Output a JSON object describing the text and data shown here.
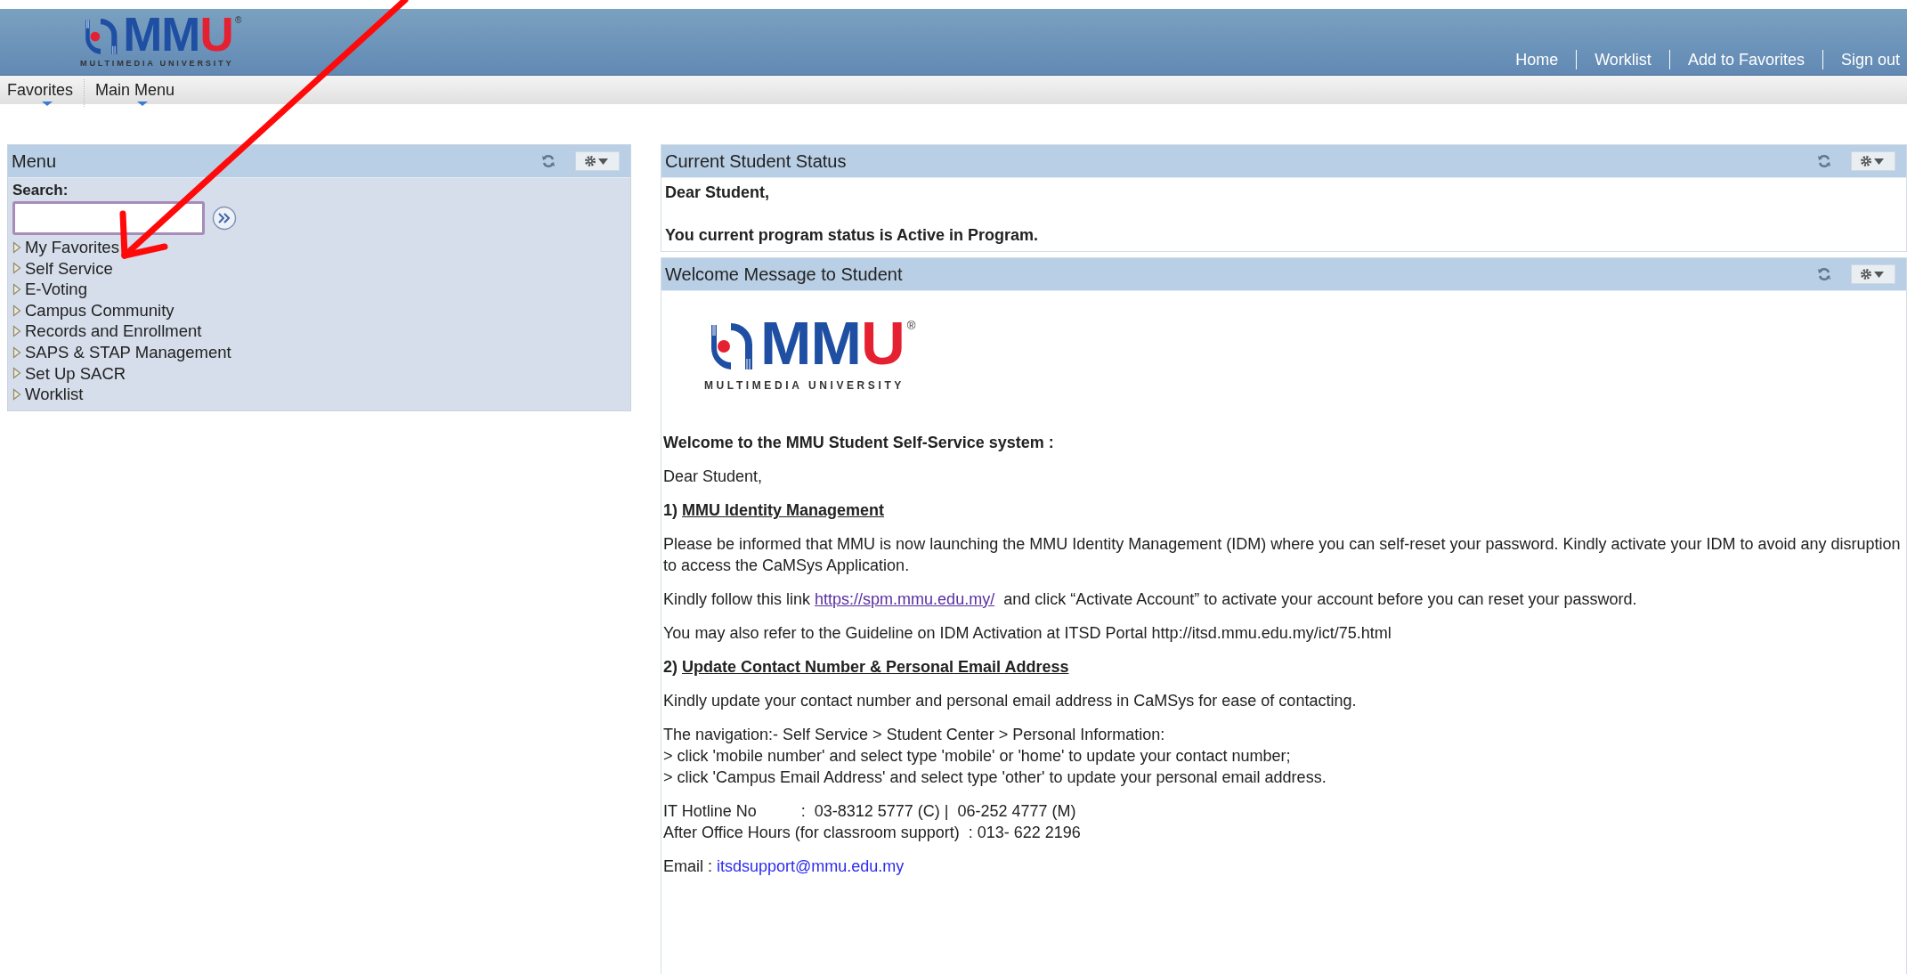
{
  "header": {
    "logo": {
      "mark": "MMU",
      "registered": "®",
      "tagline": "MULTIMEDIA UNIVERSITY"
    },
    "links": [
      "Home",
      "Worklist",
      "Add to Favorites",
      "Sign out"
    ]
  },
  "nav": [
    {
      "label": "Favorites"
    },
    {
      "label": "Main Menu"
    }
  ],
  "menu_panel": {
    "title": "Menu",
    "search": {
      "label": "Search:"
    },
    "items": [
      {
        "label": "My Favorites",
        "expanded": false
      },
      {
        "label": "Self Service",
        "expanded": false
      },
      {
        "label": "E-Voting",
        "expanded": false
      },
      {
        "label": "Campus Community",
        "expanded": false
      },
      {
        "label": "Records and Enrollment",
        "expanded": false
      },
      {
        "label": "SAPS & STAP Management",
        "expanded": false
      },
      {
        "label": "Set Up SACR",
        "expanded": false
      },
      {
        "label": "Worklist",
        "expanded": false
      }
    ]
  },
  "status_panel": {
    "title": "Current Student Status",
    "lines": [
      "Dear Student,",
      "You current program status is Active in Program."
    ]
  },
  "welcome_panel": {
    "title": "Welcome Message to Student",
    "logo": {
      "mark": "MMU",
      "registered": "®",
      "tagline": "MULTIMEDIA UNIVERSITY"
    },
    "blocks": [
      {
        "kind": "heading",
        "text": "Welcome to the MMU Student Self-Service system :"
      },
      {
        "kind": "text",
        "text": "Dear Student,"
      },
      {
        "kind": "section",
        "number": "1)",
        "title": "MMU Identity Management"
      },
      {
        "kind": "text",
        "text": "Please be informed that MMU is now launching the MMU Identity Management (IDM) where you can self-reset your password. Kindly activate your IDM to avoid any disruption to access the CaMSys Application."
      },
      {
        "kind": "link_text",
        "before": "Kindly follow this link ",
        "link": "https://spm.mmu.edu.my/",
        "after": "  and click “Activate Account” to activate your account before you can reset your password."
      },
      {
        "kind": "text",
        "text": "You may also refer to the Guideline on IDM Activation at ITSD Portal http://itsd.mmu.edu.my/ict/75.html"
      },
      {
        "kind": "section",
        "number": "2)",
        "title": "Update Contact Number & Personal Email Address"
      },
      {
        "kind": "text",
        "text": "Kindly update your contact number and personal email address in CaMSys for ease of contacting."
      },
      {
        "kind": "lines",
        "lines": [
          "The navigation:- Self Service > Student Center > Personal Information:",
          "> click 'mobile number' and select type 'mobile' or 'home' to update your contact number;",
          "> click 'Campus Email Address' and select type 'other' to update your personal email address."
        ]
      },
      {
        "kind": "lines",
        "lines": [
          "IT Hotline No          :  03-8312 5777 (C) |  06-252 4777 (M)",
          "After Office Hours (for classroom support)  : 013- 622 2196"
        ]
      },
      {
        "kind": "email",
        "label": "Email : ",
        "email": "itsdsupport@mmu.edu.my"
      }
    ]
  }
}
